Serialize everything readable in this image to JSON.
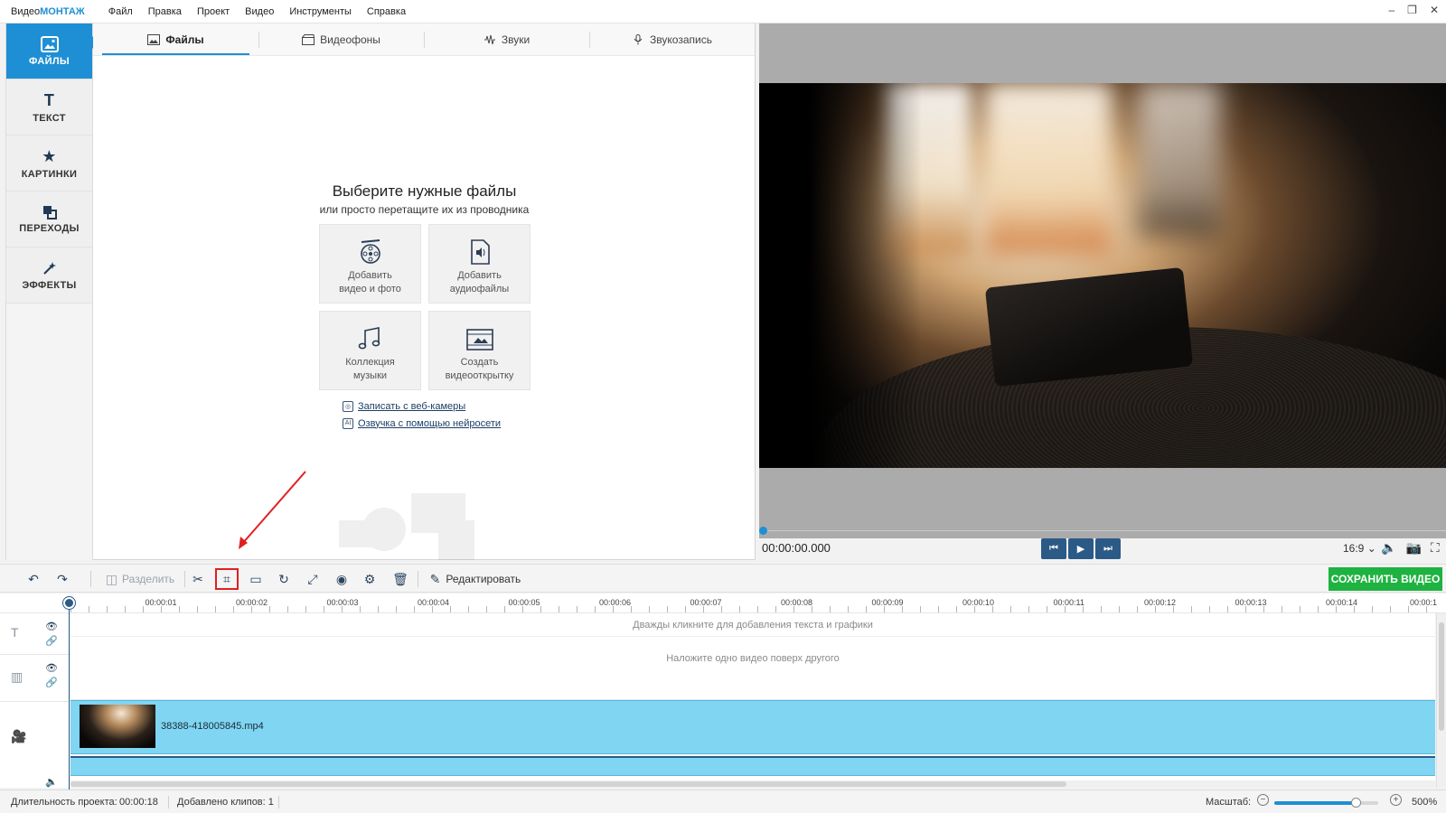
{
  "app": {
    "logo_prefix": "Видео",
    "logo_accent": "МОНТАЖ",
    "menu": [
      "Файл",
      "Правка",
      "Проект",
      "Видео",
      "Инструменты",
      "Справка"
    ],
    "window_controls": [
      "–",
      "❐",
      "✕"
    ]
  },
  "leftnav": {
    "items": [
      {
        "label": "ФАЙЛЫ",
        "icon": "image-icon",
        "active": true
      },
      {
        "label": "ТЕКСТ",
        "icon": "text-t-icon",
        "active": false
      },
      {
        "label": "КАРТИНКИ",
        "icon": "star-icon",
        "active": false
      },
      {
        "label": "ПЕРЕХОДЫ",
        "icon": "transition-squares-icon",
        "active": false
      },
      {
        "label": "ЭФФЕКТЫ",
        "icon": "magic-wand-icon",
        "active": false
      }
    ]
  },
  "files": {
    "tabs": [
      {
        "label": "Файлы",
        "icon": "image-icon",
        "active": true
      },
      {
        "label": "Видеофоны",
        "icon": "film-clapper-icon",
        "active": false
      },
      {
        "label": "Звуки",
        "icon": "waveform-icon",
        "active": false
      },
      {
        "label": "Звукозапись",
        "icon": "microphone-icon",
        "active": false
      }
    ],
    "title": "Выберите нужные файлы",
    "subtitle": "или просто перетащите их из проводника",
    "tiles": [
      {
        "line1": "Добавить",
        "line2": "видео и фото"
      },
      {
        "line1": "Добавить",
        "line2": "аудиофайлы"
      },
      {
        "line1": "Коллекция",
        "line2": "музыки"
      },
      {
        "line1": "Создать",
        "line2": "видеооткрытку"
      }
    ],
    "links": [
      {
        "label": "Записать с веб-камеры",
        "icon_glyph": "◎"
      },
      {
        "label": "Озвучка с помощью нейросети",
        "icon_glyph": "AI"
      }
    ]
  },
  "preview": {
    "timecode": "00:00:00.000",
    "aspect_ratio": "16:9",
    "controls": {
      "prev": "⏮",
      "play": "▶",
      "next": "⏭"
    },
    "right_icons": [
      "🔈",
      "📷",
      "⛶"
    ]
  },
  "toolbar": {
    "split_label": "Разделить",
    "edit_label": "Редактировать",
    "save_label": "СОХРАНИТЬ ВИДЕО",
    "glyphs": {
      "undo": "↶",
      "redo": "↷",
      "scissors": "✂",
      "crop": "⌗",
      "frame": "▭",
      "rotate": "↻",
      "resize": "⤢",
      "stabilize": "◉",
      "speed": "⚙",
      "delete": "🗑",
      "edit": "✎"
    }
  },
  "timeline": {
    "ticks": [
      "00:00:01",
      "00:00:02",
      "00:00:03",
      "00:00:04",
      "00:00:05",
      "00:00:06",
      "00:00:07",
      "00:00:08",
      "00:00:09",
      "00:00:10",
      "00:00:11",
      "00:00:12",
      "00:00:13",
      "00:00:14",
      "00:00:1"
    ],
    "text_track_hint": "Дважды кликните для добавления текста и графики",
    "overlay_track_hint": "Наложите одно видео поверх другого",
    "clip_name": "38388-418005845.mp4"
  },
  "status": {
    "duration_label": "Длительность проекта:",
    "duration_value": "00:00:18",
    "clips_label": "Добавлено клипов: 1",
    "zoom_label": "Масштаб:",
    "zoom_value": "500%",
    "zoom_fraction": 0.78
  },
  "colors": {
    "accent": "#1e8fd4",
    "save_green": "#1eb240",
    "clip_blue": "#7fd5f2",
    "dark_button": "#2b5a86",
    "annotation_red": "#e02020"
  }
}
